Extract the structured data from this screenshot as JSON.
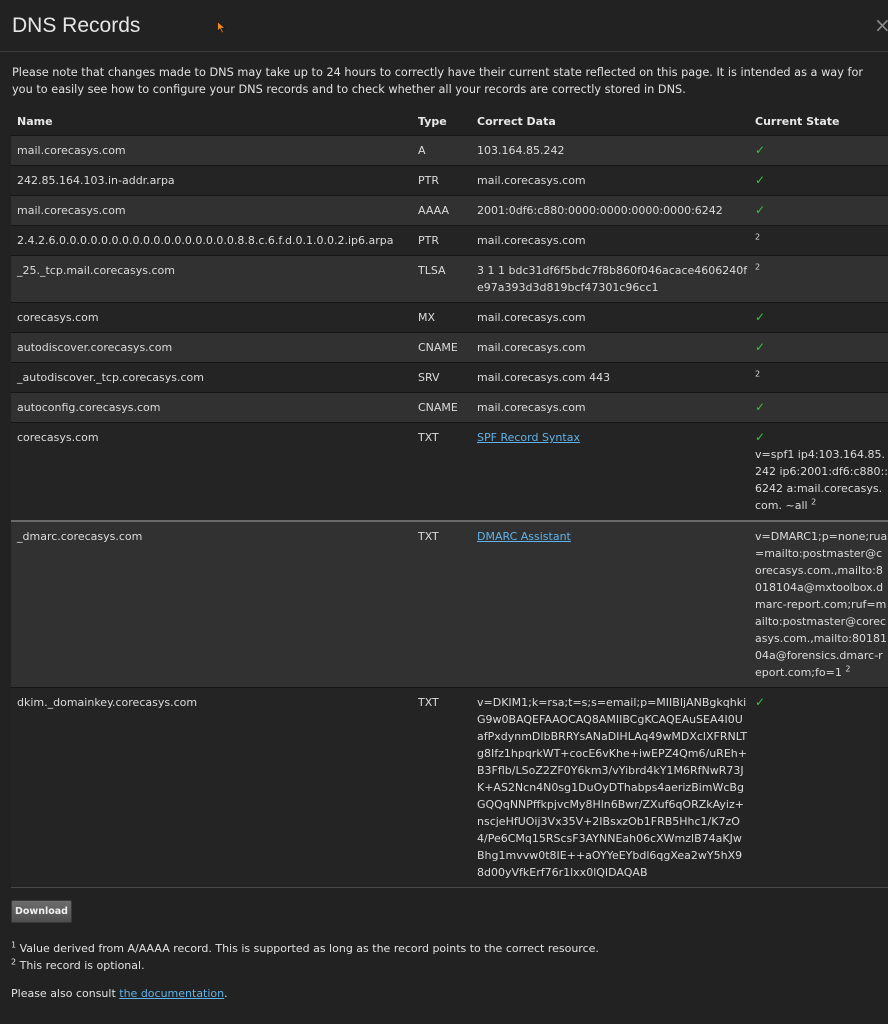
{
  "modal": {
    "title": "DNS Records",
    "close": "×"
  },
  "note": "Please note that changes made to DNS may take up to 24 hours to correctly have their current state reflected on this page. It is intended as a way for you to easily see how to configure your DNS records and to check whether all your records are correctly stored in DNS.",
  "table": {
    "headers": {
      "name": "Name",
      "type": "Type",
      "data": "Correct Data",
      "state": "Current State"
    },
    "rows": [
      {
        "name": "mail.corecasys.com",
        "type": "A",
        "data": "103.164.85.242",
        "state": "✓",
        "sup": ""
      },
      {
        "name": "242.85.164.103.in-addr.arpa",
        "type": "PTR",
        "data": "mail.corecasys.com",
        "state": "✓",
        "sup": ""
      },
      {
        "name": "mail.corecasys.com",
        "type": "AAAA",
        "data": "2001:0df6:c880:0000:0000:0000:0000:6242",
        "state": "✓",
        "sup": ""
      },
      {
        "name": "2.4.2.6.0.0.0.0.0.0.0.0.0.0.0.0.0.0.0.0.0.8.8.c.6.f.d.0.1.0.0.2.ip6.arpa",
        "type": "PTR",
        "data": "mail.corecasys.com",
        "state": "",
        "sup": "2"
      },
      {
        "name": "_25._tcp.mail.corecasys.com",
        "type": "TLSA",
        "data": "3 1 1 bdc31df6f5bdc7f8b860f046acace4606240fe97a393d3d819bcf47301c96cc1",
        "state": "",
        "sup": "2"
      },
      {
        "name": "corecasys.com",
        "type": "MX",
        "data": "mail.corecasys.com",
        "state": "✓",
        "sup": ""
      },
      {
        "name": "autodiscover.corecasys.com",
        "type": "CNAME",
        "data": "mail.corecasys.com",
        "state": "✓",
        "sup": ""
      },
      {
        "name": "_autodiscover._tcp.corecasys.com",
        "type": "SRV",
        "data": "mail.corecasys.com 443",
        "state": "",
        "sup": "2"
      },
      {
        "name": "autoconfig.corecasys.com",
        "type": "CNAME",
        "data": "mail.corecasys.com",
        "state": "✓",
        "sup": ""
      },
      {
        "name": "corecasys.com",
        "type": "TXT",
        "data_link": "SPF Record Syntax",
        "state": "✓",
        "state_text": "v=spf1 ip4:103.164.85.242 ip6:2001:df6:c880::6242 a:mail.corecasys.com. ~all",
        "sup": "2"
      },
      {
        "name": "_dmarc.corecasys.com",
        "type": "TXT",
        "data_link": "DMARC Assistant",
        "state": "",
        "state_text": "v=DMARC1;p=none;rua=mailto:postmaster@corecasys.com.,mailto:8018104a@mxtoolbox.dmarc-report.com;ruf=mailto:postmaster@corecasys.com.,mailto:8018104a@forensics.dmarc-report.com;fo=1",
        "sup": "2"
      },
      {
        "name": "dkim._domainkey.corecasys.com",
        "type": "TXT",
        "data": "v=DKIM1;k=rsa;t=s;s=email;p=MIIBIjANBgkqhkiG9w0BAQEFAAOCAQ8AMIIBCgKCAQEAuSEA4I0UafPxdynmDIbBRRYsANaDIHLAq49wMDXclXFRNLTg8Ifz1hpqrkWT+cocE6vKhe+iwEPZ4Qm6/uREh+B3Fflb/LSoZ2ZF0Y6km3/vYibrd4kY1M6RfNwR73JK+AS2Ncn4N0sg1DuOyDThabps4aerizBimWcBgGQQqNNPffkpjvcMy8Hln6Bwr/ZXuf6qORZkAyiz+nscjeHfUOij3Vx35V+2IBsxzOb1FRB5Hhc1/K7zO4/Pe6CMq15RScsF3AYNNEah06cXWmzlB74aKJwBhg1mvvw0t8IE++aOYYeEYbdl6qgXea2wY5hX98d00yVfkErf76r1lxx0lQIDAQAB",
        "state": "✓",
        "sup": ""
      }
    ]
  },
  "download_label": "Download",
  "footnotes": {
    "f1_num": "1",
    "f1_text": "Value derived from A/AAAA record. This is supported as long as the record points to the correct resource.",
    "f2_num": "2",
    "f2_text": "This record is optional.",
    "consult_prefix": "Please also consult ",
    "consult_link": "the documentation",
    "consult_suffix": "."
  },
  "colors": {
    "check": "#3cc03c",
    "link": "#5fb3ea",
    "background": "#222222"
  }
}
